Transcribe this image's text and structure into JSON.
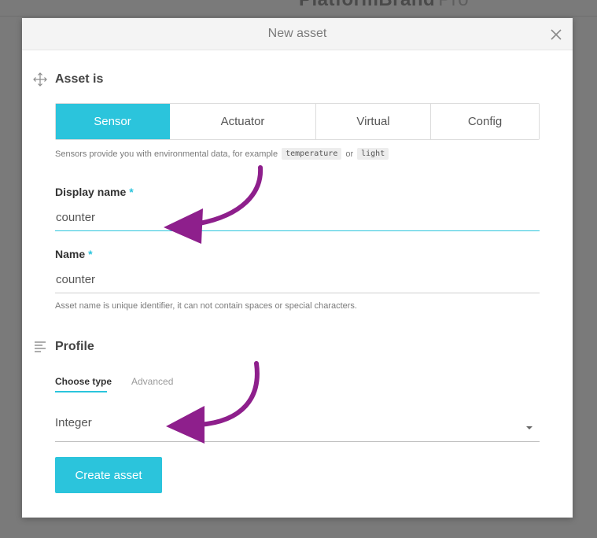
{
  "backdrop": {
    "title": "PlatformBrand",
    "title_suffix": "Pro"
  },
  "modal": {
    "title": "New asset"
  },
  "asset_is": {
    "heading": "Asset is",
    "tabs": [
      {
        "label": "Sensor",
        "active": true
      },
      {
        "label": "Actuator",
        "active": false
      },
      {
        "label": "Virtual",
        "active": false
      },
      {
        "label": "Config",
        "active": false
      }
    ],
    "helper_prefix": "Sensors provide you with environmental data, for example",
    "helper_code_1": "temperature",
    "helper_or": "or",
    "helper_code_2": "light"
  },
  "display_name": {
    "label": "Display name",
    "required_mark": "*",
    "value": "counter"
  },
  "name": {
    "label": "Name",
    "required_mark": "*",
    "value": "counter",
    "helper": "Asset name is unique identifier, it can not contain spaces or special characters."
  },
  "profile": {
    "heading": "Profile",
    "tabs": [
      {
        "label": "Choose type",
        "active": true
      },
      {
        "label": "Advanced",
        "active": false
      }
    ],
    "type_select": {
      "value": "Integer"
    }
  },
  "actions": {
    "create_label": "Create asset"
  },
  "icons": {
    "close": "close-icon",
    "asset": "move-icon",
    "profile": "align-left-icon",
    "caret": "caret-down-icon",
    "annotation": "curved-arrow-icon"
  },
  "colors": {
    "accent": "#2bc4dc",
    "annotation": "#8e1f8c"
  }
}
